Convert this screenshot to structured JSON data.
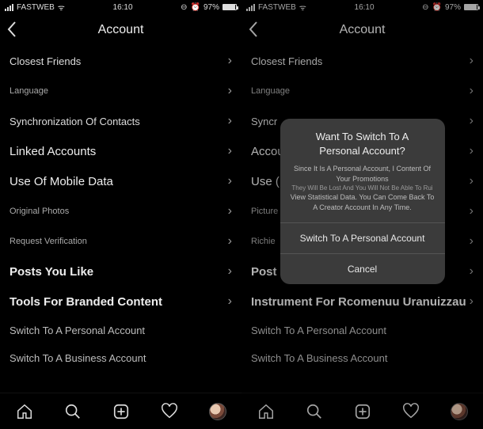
{
  "status": {
    "carrier": "FASTWEB",
    "time": "16:10",
    "battery": "97%"
  },
  "header": {
    "title": "Account"
  },
  "rows": {
    "closest": "Closest Friends",
    "language": "Language",
    "sync": "Synchronization Of Contacts",
    "sync_r": "Syncr",
    "linked": "Linked Accounts",
    "linked_r": "Accou",
    "mobile": "Use Of Mobile Data",
    "mobile_r": "Use (",
    "photos": "Original Photos",
    "photos_r": "Picture",
    "verify": "Request Verification",
    "verify_r": "Richie",
    "posts": "Posts You Like",
    "posts_r": "Post c",
    "tools": "Tools For Branded Content",
    "tools_r": "Instrument For Rcomenuu Uranuizzau"
  },
  "links": {
    "personal": "Switch To A Personal Account",
    "business": "Switch To A Business Account"
  },
  "modal": {
    "title1": "Want To Switch To A",
    "title2": "Personal Account?",
    "sub1": "Since It Is A Personal Account, I Content Of Your Promotions",
    "sub2": "They Will Be Lost And You Will Not Be Able To Rui",
    "sub3": "View Statistical Data. You Can Come Back To A Creator Account In Any Time.",
    "confirm": "Switch To A Personal Account",
    "cancel": "Cancel"
  }
}
